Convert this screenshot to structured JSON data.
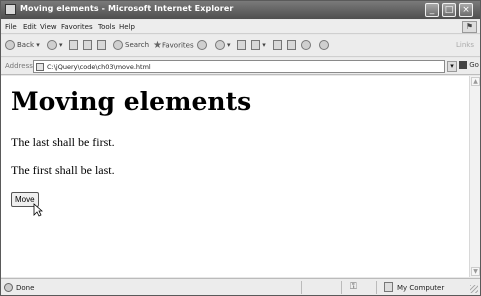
{
  "window": {
    "title": "Moving elements - Microsoft Internet Explorer",
    "controls": {
      "minimize": "_",
      "maximize": "□",
      "close": "×"
    }
  },
  "menubar": {
    "items": [
      "File",
      "Edit",
      "View",
      "Favorites",
      "Tools",
      "Help"
    ]
  },
  "toolbar": {
    "back_label": "Back",
    "search_label": "Search",
    "favorites_label": "Favorites",
    "links_label": "Links"
  },
  "address": {
    "label": "Address",
    "value": "C:\\jQuery\\code\\ch03\\move.html",
    "go_label": "Go"
  },
  "page": {
    "heading": "Moving elements",
    "paragraphs": [
      "The last shall be first.",
      "The first shall be last."
    ],
    "button_label": "Move"
  },
  "status": {
    "text": "Done",
    "zone": "My Computer"
  },
  "icons": {
    "app": "ie-page-icon",
    "back": "back-arrow-icon",
    "forward": "forward-arrow-icon",
    "stop": "stop-icon",
    "refresh": "refresh-icon",
    "home": "home-icon",
    "search": "search-icon",
    "favorites": "star-icon",
    "history": "history-icon",
    "mail": "mail-icon",
    "print": "print-icon",
    "edit": "edit-icon",
    "discuss": "discuss-icon",
    "messenger": "messenger-icon",
    "cursor": "arrow-cursor-icon"
  }
}
